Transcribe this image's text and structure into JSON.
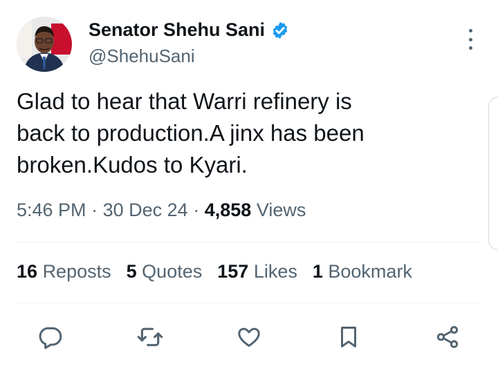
{
  "tweet": {
    "author": {
      "display_name": "Senator Shehu Sani",
      "handle": "@ShehuSani",
      "verified_icon": "verified-badge-icon"
    },
    "text_lines": [
      "Glad to hear that Warri refinery is",
      "back to production.A jinx has been",
      "broken.Kudos to Kyari."
    ],
    "meta": {
      "time": "5:46 PM",
      "separator": "·",
      "date": "30 Dec 24",
      "views_count": "4,858",
      "views_label": "Views"
    },
    "stats": [
      {
        "count": "16",
        "label": "Reposts"
      },
      {
        "count": "5",
        "label": "Quotes"
      },
      {
        "count": "157",
        "label": "Likes"
      },
      {
        "count": "1",
        "label": "Bookmark"
      }
    ]
  },
  "actions": [
    "reply-icon",
    "repost-icon",
    "like-icon",
    "bookmark-icon",
    "share-icon"
  ],
  "colors": {
    "text": "#0f1419",
    "secondary": "#536471",
    "verified": "#1d9bf0",
    "divider": "#eff3f4"
  }
}
